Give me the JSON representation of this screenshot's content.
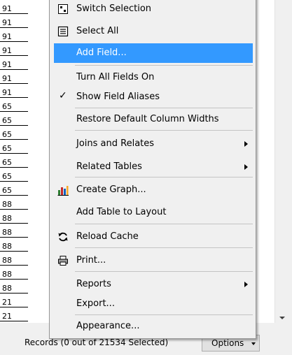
{
  "table": {
    "cells": [
      "91",
      "91",
      "91",
      "91",
      "91",
      "91",
      "91",
      "65",
      "65",
      "65",
      "65",
      "65",
      "65",
      "65",
      "88",
      "88",
      "88",
      "88",
      "88",
      "88",
      "88",
      "21",
      "21"
    ]
  },
  "menu": {
    "items": [
      {
        "label": "Switch Selection",
        "icon": "switch-selection-icon"
      },
      {
        "label": "Select All",
        "icon": "select-all-icon"
      },
      {
        "label": "Add Field...",
        "highlighted": true
      },
      {
        "label": "Turn All Fields On"
      },
      {
        "label": "Show Field Aliases",
        "checked": true
      },
      {
        "label": "Restore Default Column Widths"
      },
      {
        "label": "Joins and Relates",
        "submenu": true
      },
      {
        "label": "Related Tables",
        "submenu": true
      },
      {
        "label": "Create Graph...",
        "icon": "graph-icon"
      },
      {
        "label": "Add Table to Layout"
      },
      {
        "label": "Reload Cache",
        "icon": "reload-icon"
      },
      {
        "label": "Print...",
        "icon": "printer-icon"
      },
      {
        "label": "Reports",
        "submenu": true
      },
      {
        "label": "Export..."
      },
      {
        "label": "Appearance..."
      }
    ],
    "checkmark": "✓"
  },
  "status_bar": {
    "records_text": "Records (0 out of 21534 Selected)",
    "options_label": "Options"
  },
  "colors": {
    "highlight": "#3399ff",
    "menu_background": "#f0f0f0",
    "menu_border": "#979797"
  }
}
